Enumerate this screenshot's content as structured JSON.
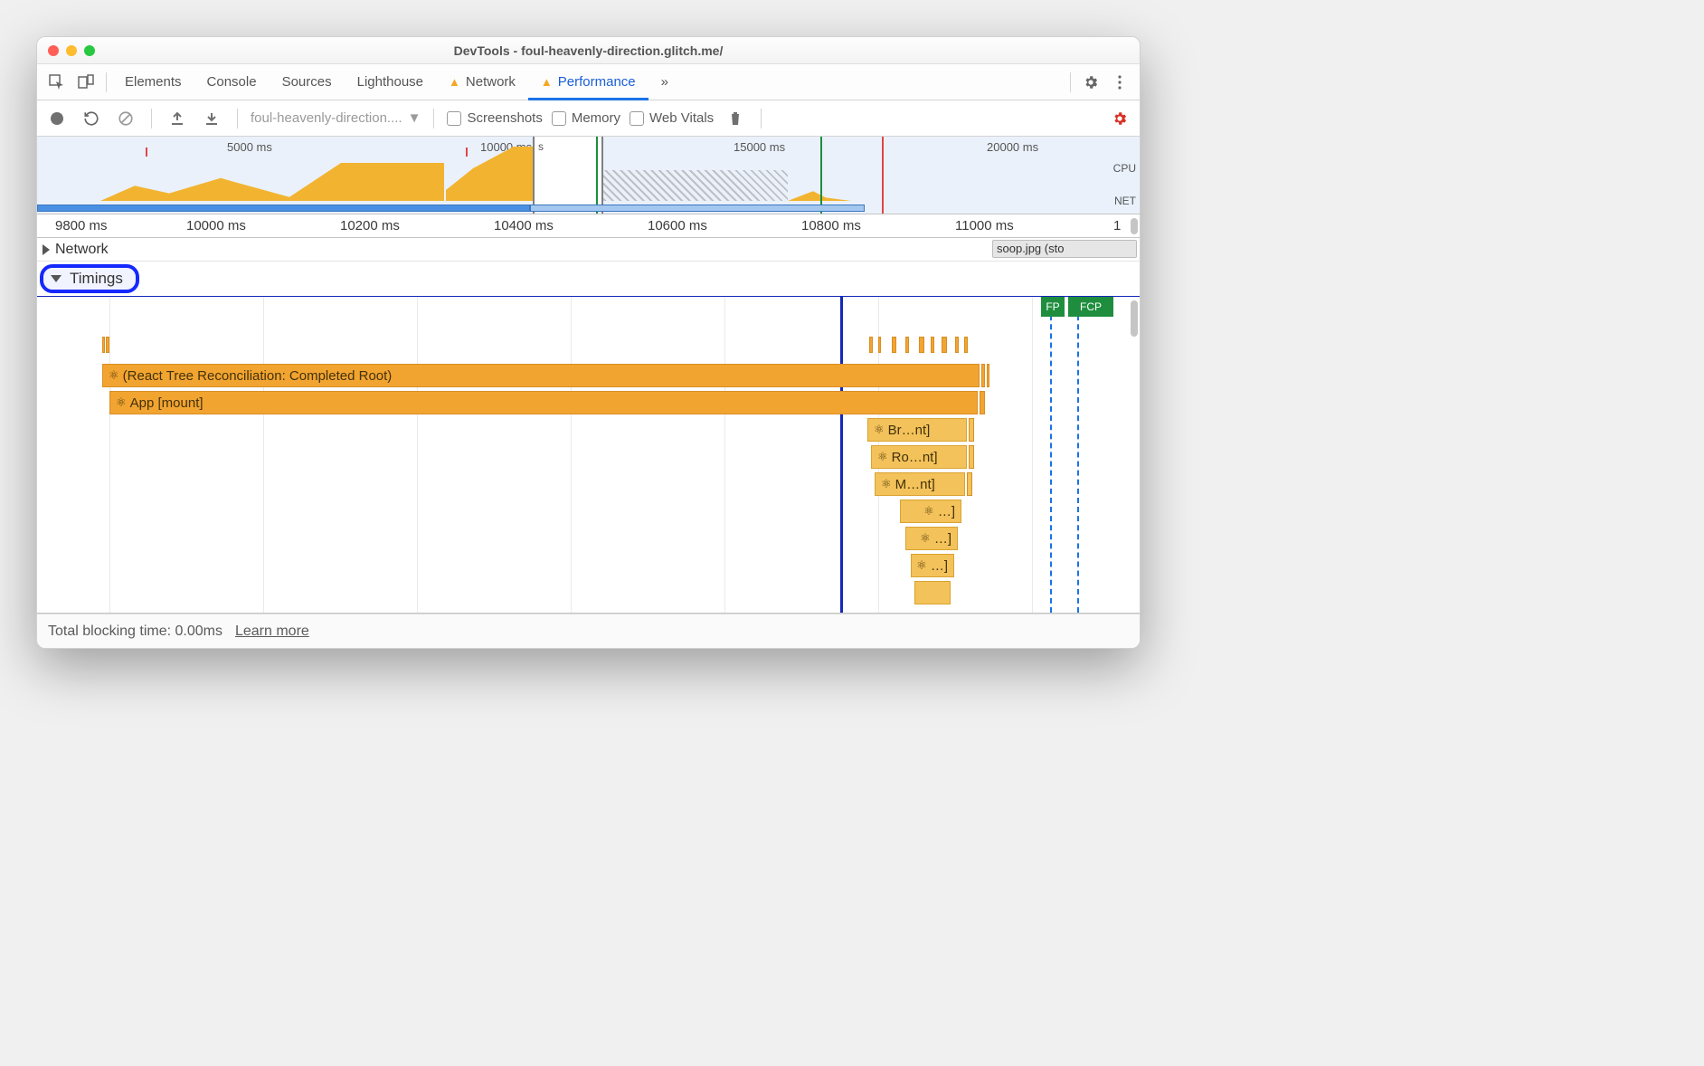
{
  "window": {
    "title": "DevTools - foul-heavenly-direction.glitch.me/"
  },
  "tabs": {
    "elements": "Elements",
    "console": "Console",
    "sources": "Sources",
    "lighthouse": "Lighthouse",
    "network": "Network",
    "performance": "Performance",
    "more": "»"
  },
  "toolbar": {
    "dropdown": "foul-heavenly-direction....",
    "screenshots": "Screenshots",
    "memory": "Memory",
    "webvitals": "Web Vitals"
  },
  "overview": {
    "ticks": [
      "5000 ms",
      "10000 ms",
      "15000 ms",
      "20000 ms"
    ],
    "rightLabels": {
      "cpu": "CPU",
      "net": "NET"
    }
  },
  "ruler": {
    "ticks": [
      "9800 ms",
      "10000 ms",
      "10200 ms",
      "10400 ms",
      "10600 ms",
      "10800 ms",
      "11000 ms",
      "1"
    ]
  },
  "tracks": {
    "network": "Network",
    "timings": "Timings",
    "networkItem": "soop.jpg (sto"
  },
  "flame": {
    "row1": "(React Tree Reconciliation: Completed Root)",
    "row2": "App [mount]",
    "sub1": "Br…nt]",
    "sub2": "Ro…nt]",
    "sub3": "M…nt]",
    "sub4": "…]",
    "sub5": "…]",
    "sub6": "…]",
    "fp": "FP",
    "fcp": "FCP"
  },
  "status": {
    "text": "Total blocking time: 0.00ms",
    "link": "Learn more"
  }
}
